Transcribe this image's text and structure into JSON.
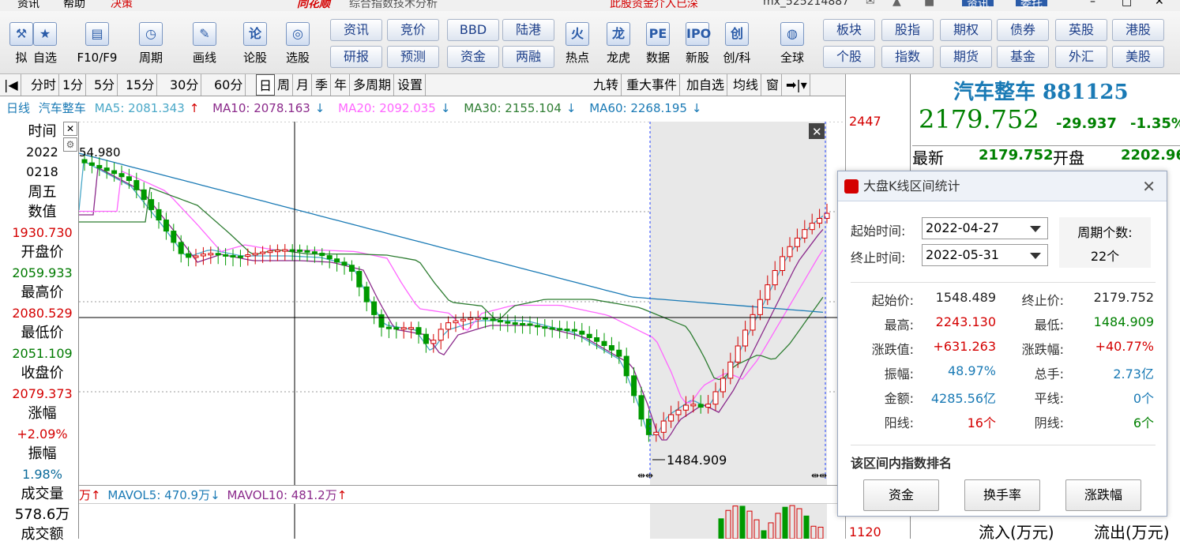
{
  "menubar": {
    "items": [
      "资讯",
      "帮助",
      "决策"
    ],
    "title": "综合指数技术分析",
    "notice": "此股资金介入已深",
    "account": "mx_525214887",
    "btn_info": "资讯",
    "btn_trust": "委托"
  },
  "toolbar": {
    "icons": [
      {
        "label": "拟",
        "icon": "tool-icon"
      },
      {
        "label": "自选",
        "icon": "star-icon"
      },
      {
        "label": "F10/F9",
        "icon": "f10-icon"
      },
      {
        "label": "周期",
        "icon": "clock-icon"
      },
      {
        "label": "画线",
        "icon": "pencil-icon"
      },
      {
        "label": "论股",
        "icon": "lun-icon"
      },
      {
        "label": "选股",
        "icon": "chart-pick-icon"
      },
      {
        "label": "热点",
        "icon": "fire-icon"
      },
      {
        "label": "龙虎",
        "icon": "dragon-icon"
      },
      {
        "label": "数据",
        "icon": "pe-icon"
      },
      {
        "label": "新股",
        "icon": "ipo-icon"
      },
      {
        "label": "创/科",
        "icon": "chuang-icon"
      },
      {
        "label": "全球",
        "icon": "globe-icon"
      }
    ],
    "buttons_top": [
      "资讯",
      "竞价",
      "BBD",
      "陆港",
      "板块",
      "股指",
      "期权",
      "债券",
      "英股",
      "港股"
    ],
    "buttons_bottom": [
      "研报",
      "预测",
      "资金",
      "两融",
      "个股",
      "指数",
      "期货",
      "基金",
      "外汇",
      "美股"
    ]
  },
  "periodbar": {
    "items": [
      "分时",
      "1分",
      "5分",
      "15分",
      "30分",
      "60分",
      "日",
      "周",
      "月",
      "季",
      "年",
      "多周期",
      "设置"
    ],
    "selected": "日",
    "right_items": [
      "九转",
      "重大事件",
      "加自选",
      "均线",
      "窗"
    ]
  },
  "malegend": {
    "period": "日线",
    "name": "汽车整车",
    "ma5": "MA5: 2081.343",
    "ma10": "MA10: 2078.163",
    "ma20": "MA20: 2092.035",
    "ma30": "MA30: 2155.104",
    "ma60": "MA60: 2268.195"
  },
  "info": {
    "time_label": "时间",
    "year": "2022",
    "date": "0218",
    "weekday": "周五",
    "value_label": "数值",
    "value": "1930.730",
    "open_label": "开盘价",
    "open": "2059.933",
    "high_label": "最高价",
    "high": "2080.529",
    "low_label": "最低价",
    "low": "2051.109",
    "close_label": "收盘价",
    "close": "2079.373",
    "chg_label": "涨幅",
    "chg": "+2.09%",
    "amp_label": "振幅",
    "amp": "1.98%",
    "vol_label": "成交量",
    "vol": "578.6万",
    "amt_label": "成交额"
  },
  "chart_annotations": {
    "start_high": "54.980",
    "min_value": "1484.909"
  },
  "volume_legend": {
    "prefix": "万",
    "mavol5": "MAVOL5: 470.9万",
    "mavol10": "MAVOL10: 481.2万"
  },
  "right_axis": {
    "top_value": "2447",
    "bottom_value": "1120"
  },
  "quote": {
    "title": "汽车整车 881125",
    "price": "2179.752",
    "change": "-29.937",
    "change_pct": "-1.35%",
    "latest_label": "最新",
    "latest": "2179.752",
    "open_label": "开盘",
    "open": "2202.96",
    "inflow_label": "流入(万元)",
    "outflow_label": "流出(万元)"
  },
  "dialog": {
    "title": "大盘K线区间统计",
    "start_label": "起始时间:",
    "start": "2022-04-27",
    "end_label": "终止时间:",
    "end": "2022-05-31",
    "periods_label": "周期个数:",
    "periods": "22个",
    "stats": [
      {
        "l1": "起始价:",
        "v1": "1548.489",
        "c1": "#222222",
        "l2": "终止价:",
        "v2": "2179.752",
        "c2": "#222222"
      },
      {
        "l1": "最高:",
        "v1": "2243.130",
        "c1": "#d40000",
        "l2": "最低:",
        "v2": "1484.909",
        "c2": "#008000"
      },
      {
        "l1": "涨跌值:",
        "v1": "+631.263",
        "c1": "#d40000",
        "l2": "涨跌幅:",
        "v2": "+40.77%",
        "c2": "#d40000"
      },
      {
        "l1": "振幅:",
        "v1": "48.97%",
        "c1": "#1a7ab5",
        "l2": "总手:",
        "v2": "2.73亿",
        "c2": "#1a7ab5"
      },
      {
        "l1": "金额:",
        "v1": "4285.56亿",
        "c1": "#1a7ab5",
        "l2": "平线:",
        "v2": "0个",
        "c2": "#1a7ab5"
      },
      {
        "l1": "阳线:",
        "v1": "16个",
        "c1": "#d40000",
        "l2": "阴线:",
        "v2": "6个",
        "c2": "#008000"
      }
    ],
    "rank_label": "该区间内指数排名",
    "buttons": [
      "资金",
      "换手率",
      "涨跌幅"
    ]
  },
  "colors": {
    "up": "#d40000",
    "down": "#009900",
    "ma5": "#4aa8c8",
    "ma10": "#8b2a8b",
    "ma20": "#ff66ff",
    "ma30": "#2e7d32",
    "ma60": "#1a7ab5"
  }
}
